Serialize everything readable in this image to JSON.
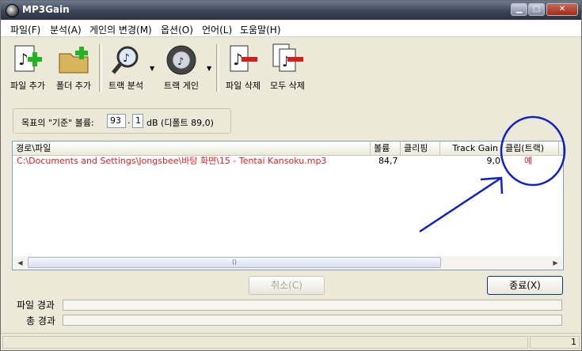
{
  "window": {
    "title": "MP3Gain"
  },
  "menu": [
    "파일(F)",
    "분석(A)",
    "게인의 변경(M)",
    "옵션(O)",
    "언어(L)",
    "도움말(H)"
  ],
  "toolbar": {
    "add_file": "파일 추가",
    "add_folder": "폴더 추가",
    "track_analysis": "트랙 분석",
    "track_gain": "트랙 게인",
    "delete_file": "파일 삭제",
    "delete_all": "모두 삭제"
  },
  "target": {
    "label": "목표의 \"기준\" 볼륨:",
    "int_value": "93",
    "dot": ".",
    "dec_value": "1",
    "unit_text": "dB  (디폴트 89,0)"
  },
  "list": {
    "columns": [
      "경로\\파일",
      "볼륨",
      "클리핑",
      "Track Gain",
      "클립(트랙)"
    ],
    "rows": [
      {
        "path": "C:\\Documents and Settings\\Jongsbee\\바탕 화면\\15 - Tentai Kansoku.mp3",
        "volume": "84,7",
        "clipping": "",
        "track_gain": "9,0",
        "clip_track": "예"
      }
    ],
    "scroll_thumb": "⟨⟩"
  },
  "buttons": {
    "cancel": "취소(C)",
    "exit": "종료(X)"
  },
  "progress": {
    "file_label": "파일 경과",
    "total_label": "총 경과"
  },
  "status": {
    "count": "1"
  },
  "colors": {
    "red_text": "#e52020",
    "annotation_blue": "#1020c8"
  }
}
